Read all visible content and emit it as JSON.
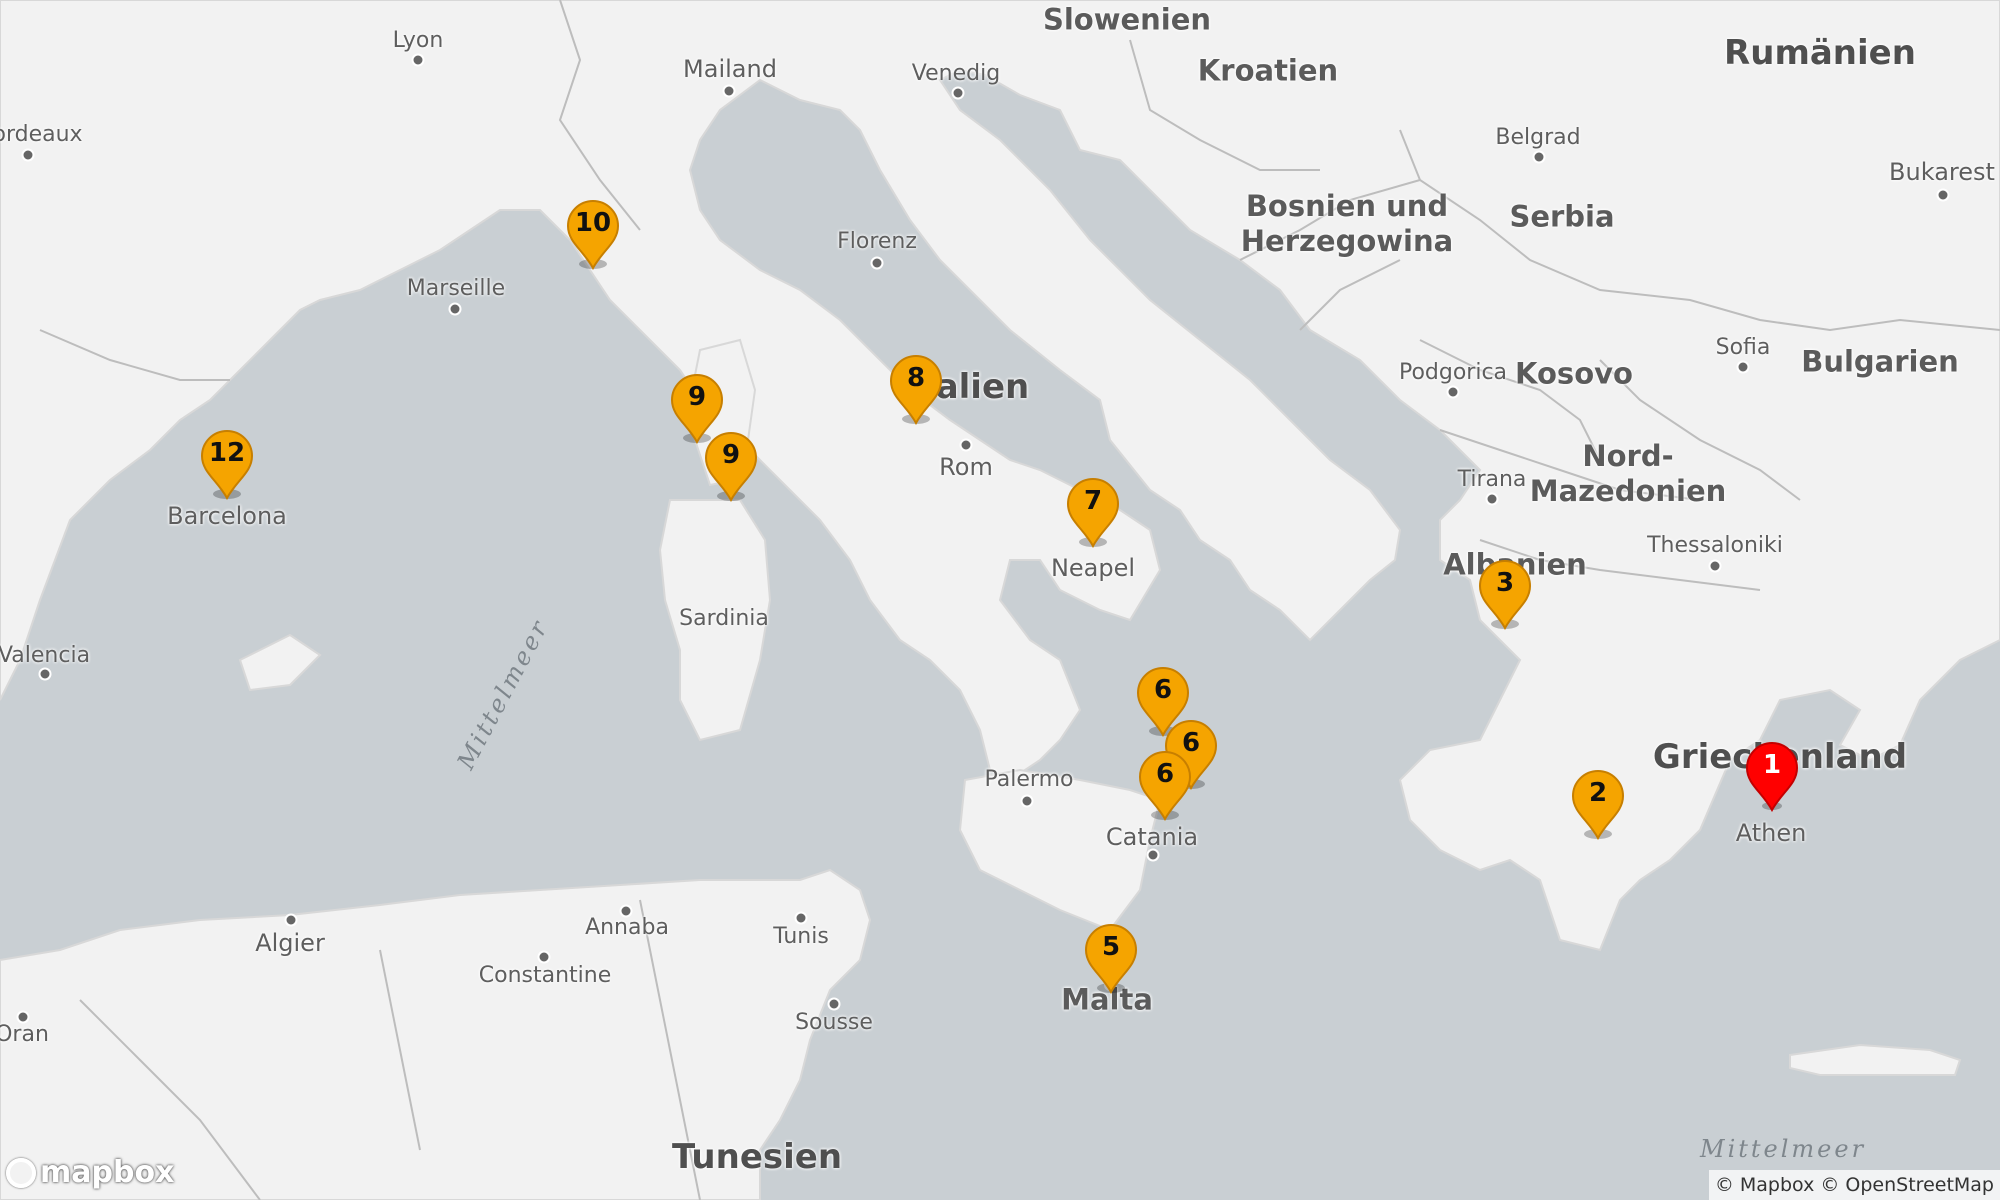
{
  "map": {
    "colors": {
      "sea": "#c9cfd3",
      "land": "#f2f2f2",
      "border": "#bdbdbd",
      "pin_orange": "#f5a400",
      "pin_red": "#ff0000"
    },
    "countries": {
      "slowenien": "Slowenien",
      "kroatien": "Kroatien",
      "rumaenien": "Rumänien",
      "bosnien": "Bosnien und\nHerzegowina",
      "serbia": "Serbia",
      "kosovo": "Kosovo",
      "nordmazedonien": "Nord-\nMazedonien",
      "albanien": "Albanien",
      "bulgarien": "Bulgarien",
      "italien": "Italien",
      "griechenland": "Griechenland",
      "tunesien": "Tunesien",
      "malta": "Malta"
    },
    "cities": {
      "lyon": "Lyon",
      "bordeaux": "Bordeaux",
      "mailand": "Mailand",
      "venedig": "Venedig",
      "belgrad": "Belgrad",
      "bukarest": "Bukarest",
      "florenz": "Florenz",
      "marseille": "Marseille",
      "sofia": "Sofia",
      "podgorica": "Podgorica",
      "rom": "Rom",
      "tirana": "Tirana",
      "thessaloniki": "Thessaloniki",
      "barcelona": "Barcelona",
      "neapel": "Neapel",
      "sardinia": "Sardinia",
      "valencia": "Valencia",
      "palermo": "Palermo",
      "catania": "Catania",
      "athen": "Athen",
      "algier": "Algier",
      "annaba": "Annaba",
      "tunis": "Tunis",
      "constantine": "Constantine",
      "sousse": "Sousse",
      "oran": "Oran"
    },
    "seas": {
      "mittelmeer_west": "Mittelmeer",
      "mittelmeer_east": "Mittelmeer"
    },
    "markers": [
      {
        "id": "barcelona",
        "label": "12",
        "color": "orange"
      },
      {
        "id": "nice",
        "label": "10",
        "color": "orange"
      },
      {
        "id": "corsica-north",
        "label": "9",
        "color": "orange"
      },
      {
        "id": "corsica-south",
        "label": "9",
        "color": "orange"
      },
      {
        "id": "civitavecchia",
        "label": "8",
        "color": "orange"
      },
      {
        "id": "neapel",
        "label": "7",
        "color": "orange"
      },
      {
        "id": "calabria-a",
        "label": "6",
        "color": "orange"
      },
      {
        "id": "calabria-b",
        "label": "6",
        "color": "orange"
      },
      {
        "id": "messina",
        "label": "6",
        "color": "orange"
      },
      {
        "id": "malta",
        "label": "5",
        "color": "orange"
      },
      {
        "id": "albania",
        "label": "3",
        "color": "orange"
      },
      {
        "id": "peloponnese",
        "label": "2",
        "color": "orange"
      },
      {
        "id": "athen",
        "label": "1",
        "color": "red"
      }
    ],
    "attribution": "© Mapbox © OpenStreetMap",
    "logo": "mapbox"
  }
}
